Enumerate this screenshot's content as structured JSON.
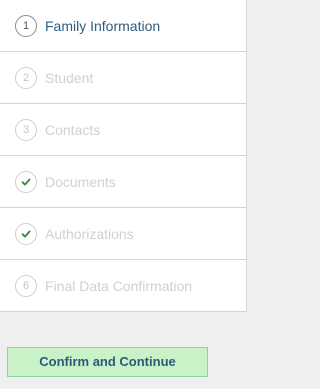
{
  "steps": [
    {
      "marker": "1",
      "label": "Family Information",
      "state": "active",
      "icon": null
    },
    {
      "marker": "2",
      "label": "Student",
      "state": "inactive",
      "icon": null
    },
    {
      "marker": "3",
      "label": "Contacts",
      "state": "inactive",
      "icon": null
    },
    {
      "marker": "",
      "label": "Documents",
      "state": "complete",
      "icon": "checkmark-icon"
    },
    {
      "marker": "",
      "label": "Authorizations",
      "state": "complete",
      "icon": "checkmark-icon"
    },
    {
      "marker": "6",
      "label": "Final Data Confirmation",
      "state": "inactive",
      "icon": null
    }
  ],
  "footer": {
    "confirm_label": "Confirm and Continue"
  },
  "colors": {
    "active_label": "#2f5c7e",
    "inactive_label": "#d0d0d0",
    "check": "#2e8b3c",
    "button_bg": "#c9f2c8",
    "button_border": "#8fd39a"
  }
}
